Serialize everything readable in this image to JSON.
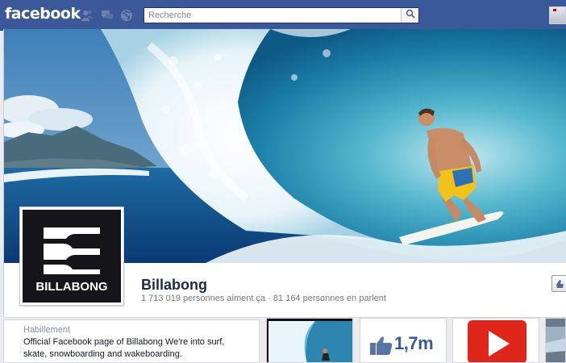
{
  "topbar": {
    "logo": "facebook",
    "search_placeholder": "Recherche",
    "icons": [
      "friend-requests-icon",
      "messages-icon",
      "notifications-icon",
      "search-icon"
    ]
  },
  "page": {
    "name": "Billabong",
    "likes_text": "1 713 019 personnes aiment ça",
    "separator": "·",
    "talking_text": "81 164 personnes en parlent",
    "profile_logo_text": "BILLABONG"
  },
  "about": {
    "category": "Habillement",
    "description": "Official Facebook page of Billabong We're into surf, skate, snowboarding and wakeboarding."
  },
  "apps": {
    "likes_count": "1,7m"
  },
  "colors": {
    "facebook_blue": "#3b5998",
    "page_name": "#1c2a47",
    "video_red": "#e0261b"
  }
}
